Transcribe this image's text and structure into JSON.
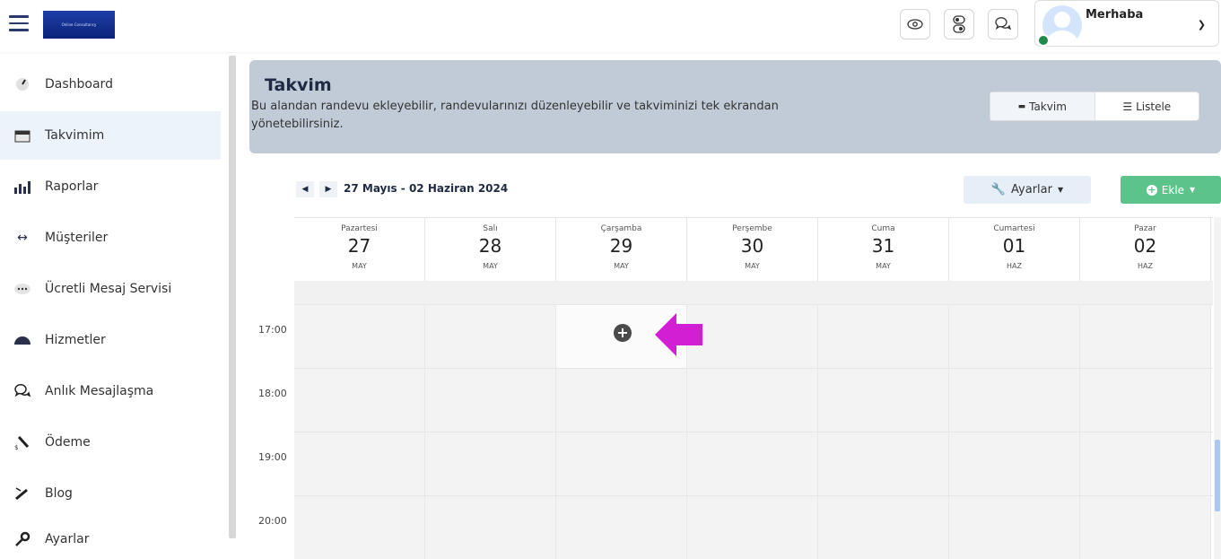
{
  "header": {
    "logo_text": "Online Consultancy",
    "greeting": "Merhaba",
    "icons": [
      "eye-icon",
      "toggle-icon",
      "chat-icon"
    ]
  },
  "sidebar": {
    "items": [
      {
        "label": "Dashboard",
        "icon": "gauge-icon"
      },
      {
        "label": "Takvimim",
        "icon": "calendar-icon",
        "active": true
      },
      {
        "label": "Raporlar",
        "icon": "bar-chart-icon"
      },
      {
        "label": "Müşteriler",
        "icon": "arrows-horizontal-icon"
      },
      {
        "label": "Ücretli Mesaj Servisi",
        "icon": "dots-bubble-icon"
      },
      {
        "label": "Hizmetler",
        "icon": "dome-icon"
      },
      {
        "label": "Anlık Mesajlaşma",
        "icon": "chat-icon"
      },
      {
        "label": "Ödeme",
        "icon": "payment-icon"
      },
      {
        "label": "Blog",
        "icon": "pencil-icon"
      },
      {
        "label": "Ayarlar",
        "icon": "wrench-icon"
      }
    ]
  },
  "panel": {
    "title": "Takvim",
    "description": "Bu alandan randevu ekleyebilir, randevularınızı düzenleyebilir ve takviminizi tek ekrandan yönetebilirsiniz.",
    "view_calendar": "Takvim",
    "view_list": "Listele"
  },
  "toolbar": {
    "range": "27 Mayıs - 02 Haziran 2024",
    "settings_label": "Ayarlar",
    "add_label": "Ekle"
  },
  "calendar": {
    "days": [
      {
        "name": "Pazartesi",
        "num": "27",
        "month": "MAY"
      },
      {
        "name": "Salı",
        "num": "28",
        "month": "MAY"
      },
      {
        "name": "Çarşamba",
        "num": "29",
        "month": "MAY"
      },
      {
        "name": "Perşembe",
        "num": "30",
        "month": "MAY"
      },
      {
        "name": "Cuma",
        "num": "31",
        "month": "MAY"
      },
      {
        "name": "Cumartesi",
        "num": "01",
        "month": "HAZ"
      },
      {
        "name": "Pazar",
        "num": "02",
        "month": "HAZ"
      }
    ],
    "times": [
      "17:00",
      "18:00",
      "19:00",
      "20:00"
    ],
    "accent_arrow": "#d31fd3"
  }
}
